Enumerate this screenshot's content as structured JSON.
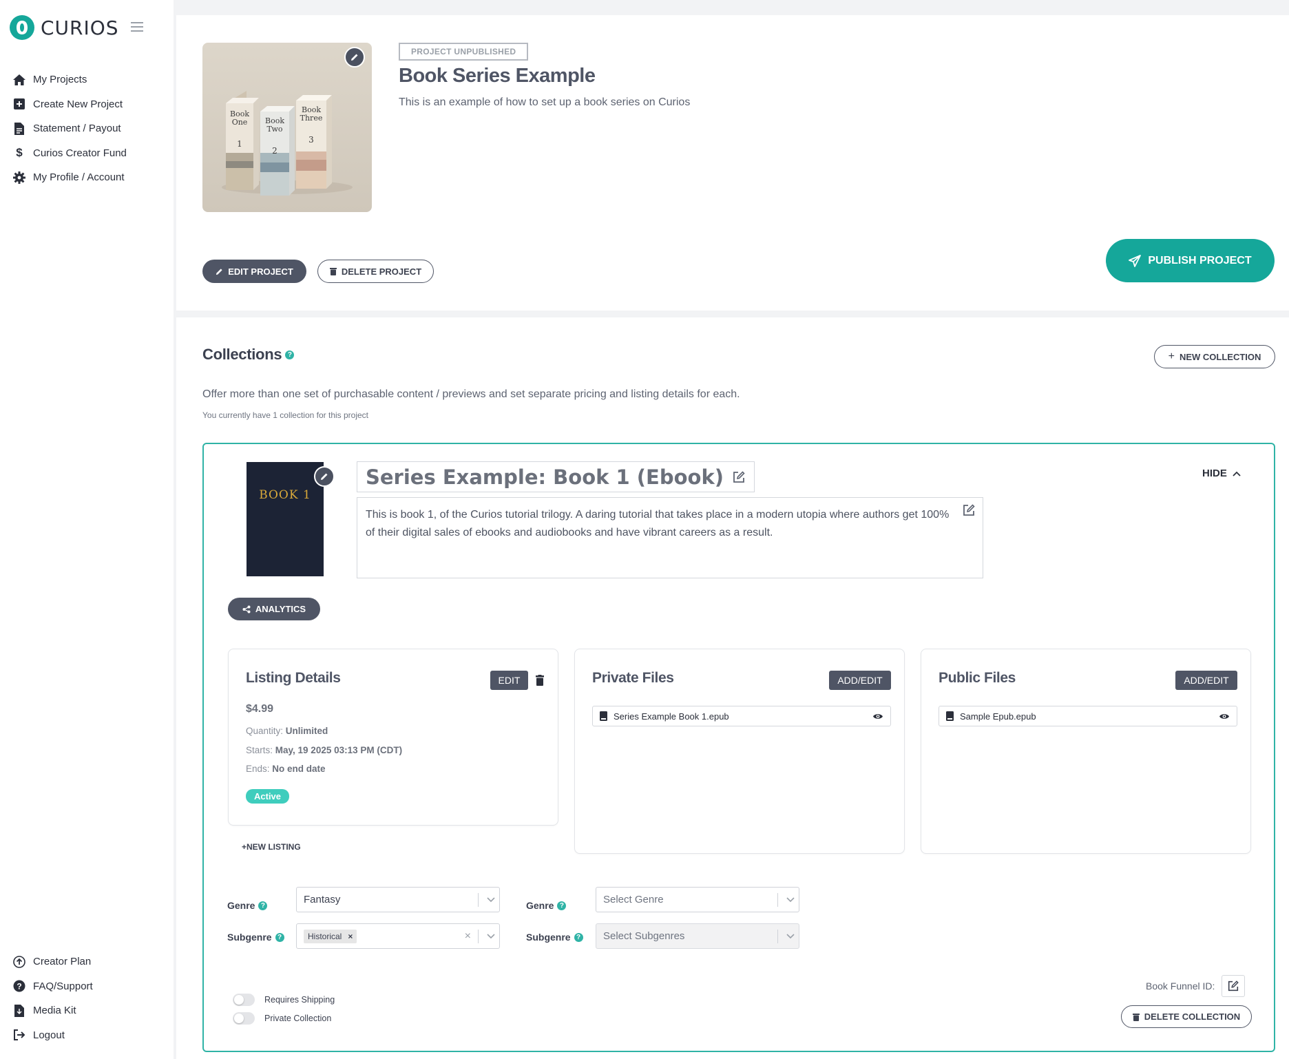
{
  "brand": {
    "name": "CURIOS",
    "accent": "#15a79a"
  },
  "sidebar": {
    "items": [
      {
        "label": "My Projects",
        "icon": "home-icon"
      },
      {
        "label": "Create New Project",
        "icon": "plus-square-icon"
      },
      {
        "label": "Statement / Payout",
        "icon": "file-invoice-icon"
      },
      {
        "label": "Curios Creator Fund",
        "icon": "dollar-icon"
      },
      {
        "label": "My Profile / Account",
        "icon": "gear-icon"
      }
    ],
    "bottom_items": [
      {
        "label": "Creator Plan",
        "icon": "arrow-up-circle-icon"
      },
      {
        "label": "FAQ/Support",
        "icon": "question-circle-icon"
      },
      {
        "label": "Media Kit",
        "icon": "file-icon"
      },
      {
        "label": "Logout",
        "icon": "logout-icon"
      }
    ]
  },
  "project": {
    "status": "PROJECT UNPUBLISHED",
    "title": "Book Series Example",
    "subtitle": "This is an example of how to set up a book series on Curios",
    "cover_book_labels": [
      "Book One",
      "Book Two",
      "Book Three"
    ],
    "cover_book_numbers": [
      "1",
      "2",
      "3"
    ],
    "edit_label": "EDIT PROJECT",
    "delete_label": "DELETE PROJECT",
    "publish_label": "PUBLISH PROJECT"
  },
  "collections": {
    "title": "Collections",
    "new_label": "NEW COLLECTION",
    "description": "Offer more than one set of purchasable content / previews and set separate pricing and listing details for each.",
    "count_text": "You currently have 1 collection for this project",
    "item": {
      "cover_text": "BOOK 1",
      "name": "Series Example: Book 1 (Ebook)",
      "body": "This is book 1, of the Curios tutorial trilogy. A daring tutorial that takes place in a modern utopia where authors get 100% of their digital sales of ebooks and audiobooks and have vibrant careers as a result.",
      "hide_label": "HIDE",
      "analytics_label": "ANALYTICS",
      "listing": {
        "title": "Listing Details",
        "edit_label": "EDIT",
        "price": "$4.99",
        "quantity_label": "Quantity:",
        "quantity_value": "Unlimited",
        "starts_label": "Starts:",
        "starts_value": "May, 19 2025 03:13 PM (CDT)",
        "ends_label": "Ends:",
        "ends_value": "No end date",
        "status": "Active"
      },
      "private_files": {
        "title": "Private Files",
        "button": "ADD/EDIT",
        "files": [
          "Series Example Book 1.epub"
        ]
      },
      "public_files": {
        "title": "Public Files",
        "button": "ADD/EDIT",
        "files": [
          "Sample Epub.epub"
        ]
      },
      "new_listing_label": "+NEW LISTING",
      "genre1": {
        "genre_label": "Genre",
        "genre_value": "Fantasy",
        "subgenre_label": "Subgenre",
        "subgenre_tag": "Historical"
      },
      "genre2": {
        "genre_label": "Genre",
        "genre_placeholder": "Select Genre",
        "subgenre_label": "Subgenre",
        "subgenre_placeholder": "Select Subgenres"
      },
      "toggles": {
        "shipping": "Requires Shipping",
        "private": "Private Collection"
      },
      "funnel_label": "Book Funnel ID:",
      "delete_label": "DELETE COLLECTION"
    }
  }
}
